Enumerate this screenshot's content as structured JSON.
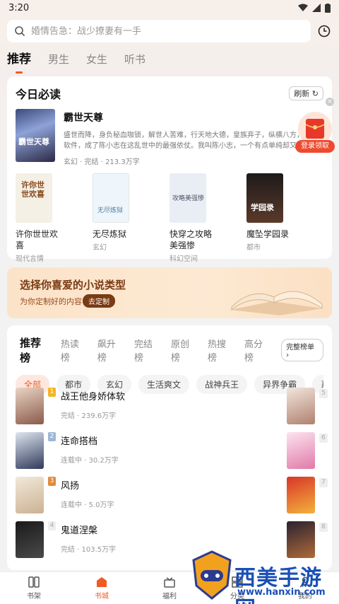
{
  "status_bar": {
    "time": "3:20"
  },
  "search": {
    "placeholder": "婚情告急：战少撩妻有一手"
  },
  "tabs": [
    {
      "label": "推荐",
      "active": true
    },
    {
      "label": "男生"
    },
    {
      "label": "女生"
    },
    {
      "label": "听书"
    }
  ],
  "today": {
    "title": "今日必读",
    "refresh_label": "刷新",
    "featured": {
      "title": "霸世天尊",
      "desc": "盛世而降，身负秘血咖锁，解世人苦难，行天地大德，皇族弃子，纵横八方，前药软件，成了陈小志在这乱世中的最强依仗。我叫陈小志，一个有点单纯却又豪",
      "meta": "玄幻 · 完结 · 213.3万字",
      "cover_text": "霸世天尊"
    },
    "books": [
      {
        "title": "许你世世欢喜",
        "tag": "现代言情",
        "cover_text": "许你世世欢喜",
        "cover_color": "#f4f0e6"
      },
      {
        "title": "无尽炼狱",
        "tag": "玄幻",
        "cover_text": "无尽炼狱",
        "cover_color": "#eef6fb"
      },
      {
        "title": "快穿之攻略美强惨",
        "tag": "科幻空间",
        "cover_text": "攻略美强惨",
        "cover_color": "#e9eef5"
      },
      {
        "title": "魔坠学园录",
        "tag": "都市",
        "cover_text": "学园录",
        "cover_color": "#3a2a22"
      }
    ]
  },
  "login_float": {
    "label": "登录领取"
  },
  "banner": {
    "title": "选择你喜爱的小说类型",
    "sub": "为你定制好的内容",
    "button": "去定制"
  },
  "rank": {
    "tabs": [
      "推荐榜",
      "热读榜",
      "飙升榜",
      "完结榜",
      "原创榜",
      "热搜榜",
      "高分榜"
    ],
    "full_label": "完整榜单",
    "chips": [
      "全部",
      "都市",
      "玄幻",
      "生活爽文",
      "战神兵王",
      "异界争霸",
      "系统升级"
    ],
    "items": [
      {
        "rank": "1",
        "title": "战王他身娇体软",
        "meta": "完结 · 239.6万字",
        "badge_color": "#f5b423",
        "right_num": "5"
      },
      {
        "rank": "2",
        "title": "连命搭档",
        "meta": "连载中 · 30.2万字",
        "badge_color": "#9fb6d6",
        "right_num": "6"
      },
      {
        "rank": "3",
        "title": "风扬",
        "meta": "连载中 · 5.0万字",
        "badge_color": "#e08a3c",
        "right_num": "7"
      },
      {
        "rank": "4",
        "title": "鬼道涅槃",
        "meta": "完结 · 103.5万字",
        "badge_color": "#eeeeee",
        "right_num": "8"
      }
    ]
  },
  "nav": [
    {
      "label": "书架",
      "icon": "bookshelf-icon"
    },
    {
      "label": "书城",
      "icon": "bookstore-icon",
      "active": true
    },
    {
      "label": "福利",
      "icon": "gift-icon"
    },
    {
      "label": "分类",
      "icon": "category-icon"
    },
    {
      "label": "我的",
      "icon": "profile-icon"
    }
  ],
  "watermark": {
    "text": "西美手游网",
    "url": "www.hanxin.com"
  },
  "colors": {
    "accent": "#f15a24",
    "banner_dark": "#7a3a14"
  }
}
